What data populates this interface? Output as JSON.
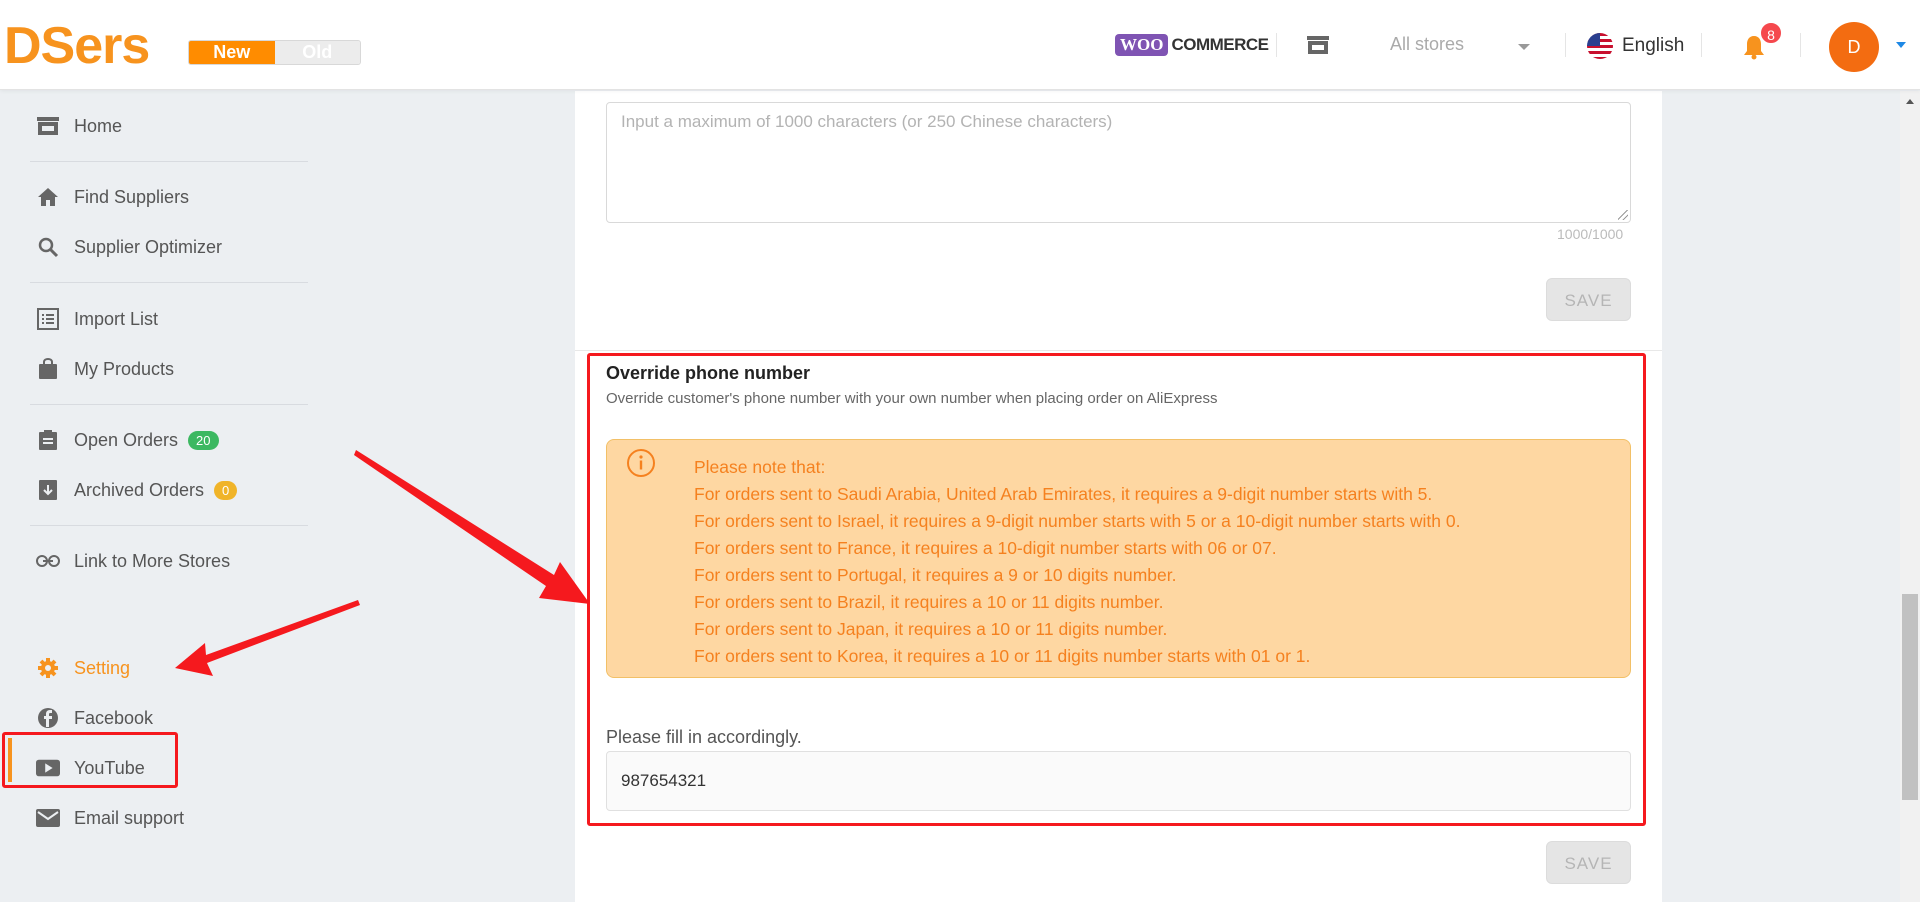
{
  "header": {
    "logo": "DSers",
    "version_new": "New",
    "version_old": "Old",
    "platform_badge": "WOO",
    "platform_text": "COMMERCE",
    "store_select": "All stores",
    "language": "English",
    "notification_count": "8",
    "avatar_initial": "D",
    "icons": [
      "store-icon",
      "us-flag-icon",
      "bell-icon",
      "chevron-down-icon"
    ]
  },
  "sidebar": {
    "items": [
      {
        "label": "Home",
        "icon": "store-icon"
      },
      {
        "label": "Find Suppliers",
        "icon": "home-icon"
      },
      {
        "label": "Supplier Optimizer",
        "icon": "search-icon"
      },
      {
        "label": "Import List",
        "icon": "list-icon"
      },
      {
        "label": "My Products",
        "icon": "bag-icon"
      },
      {
        "label": "Open Orders",
        "icon": "clipboard-icon",
        "badge": "20",
        "badge_color": "#3cb861"
      },
      {
        "label": "Archived Orders",
        "icon": "archive-icon",
        "badge": "0",
        "badge_color": "#f0b429"
      },
      {
        "label": "Link to More Stores",
        "icon": "link-icon"
      },
      {
        "label": "Setting",
        "icon": "gear-icon"
      },
      {
        "label": "Facebook",
        "icon": "facebook-icon"
      },
      {
        "label": "YouTube",
        "icon": "youtube-icon"
      },
      {
        "label": "Email support",
        "icon": "email-icon"
      }
    ],
    "active": "Setting"
  },
  "main": {
    "textarea_placeholder": "Input a maximum of 1000 characters (or 250 Chinese characters)",
    "char_count": "1000/1000",
    "save_label": "SAVE",
    "phone_section": {
      "title": "Override phone number",
      "subtitle": "Override customer's phone number with your own number when placing order on AliExpress",
      "note_lines": [
        "Please note that:",
        "For orders sent to Saudi Arabia, United Arab Emirates, it requires a 9-digit number starts with 5.",
        "For orders sent to Israel, it requires a 9-digit number starts with 5 or a 10-digit number starts with 0.",
        "For orders sent to France, it requires a 10-digit number starts with 06 or 07.",
        "For orders sent to Portugal, it requires a 9 or 10 digits number.",
        "For orders sent to Brazil, it requires a 10 or 11 digits number.",
        "For orders sent to Japan, it requires a 10 or 11 digits number.",
        "For orders sent to Korea, it requires a 10 or 11 digits number starts with 01 or 1."
      ],
      "fill_label": "Please fill in accordingly.",
      "phone_value": "987654321"
    }
  },
  "colors": {
    "brand": "#f7931e",
    "annotation_red": "#f5191e",
    "note_bg": "#fed7a2",
    "note_text": "#f5811f"
  }
}
